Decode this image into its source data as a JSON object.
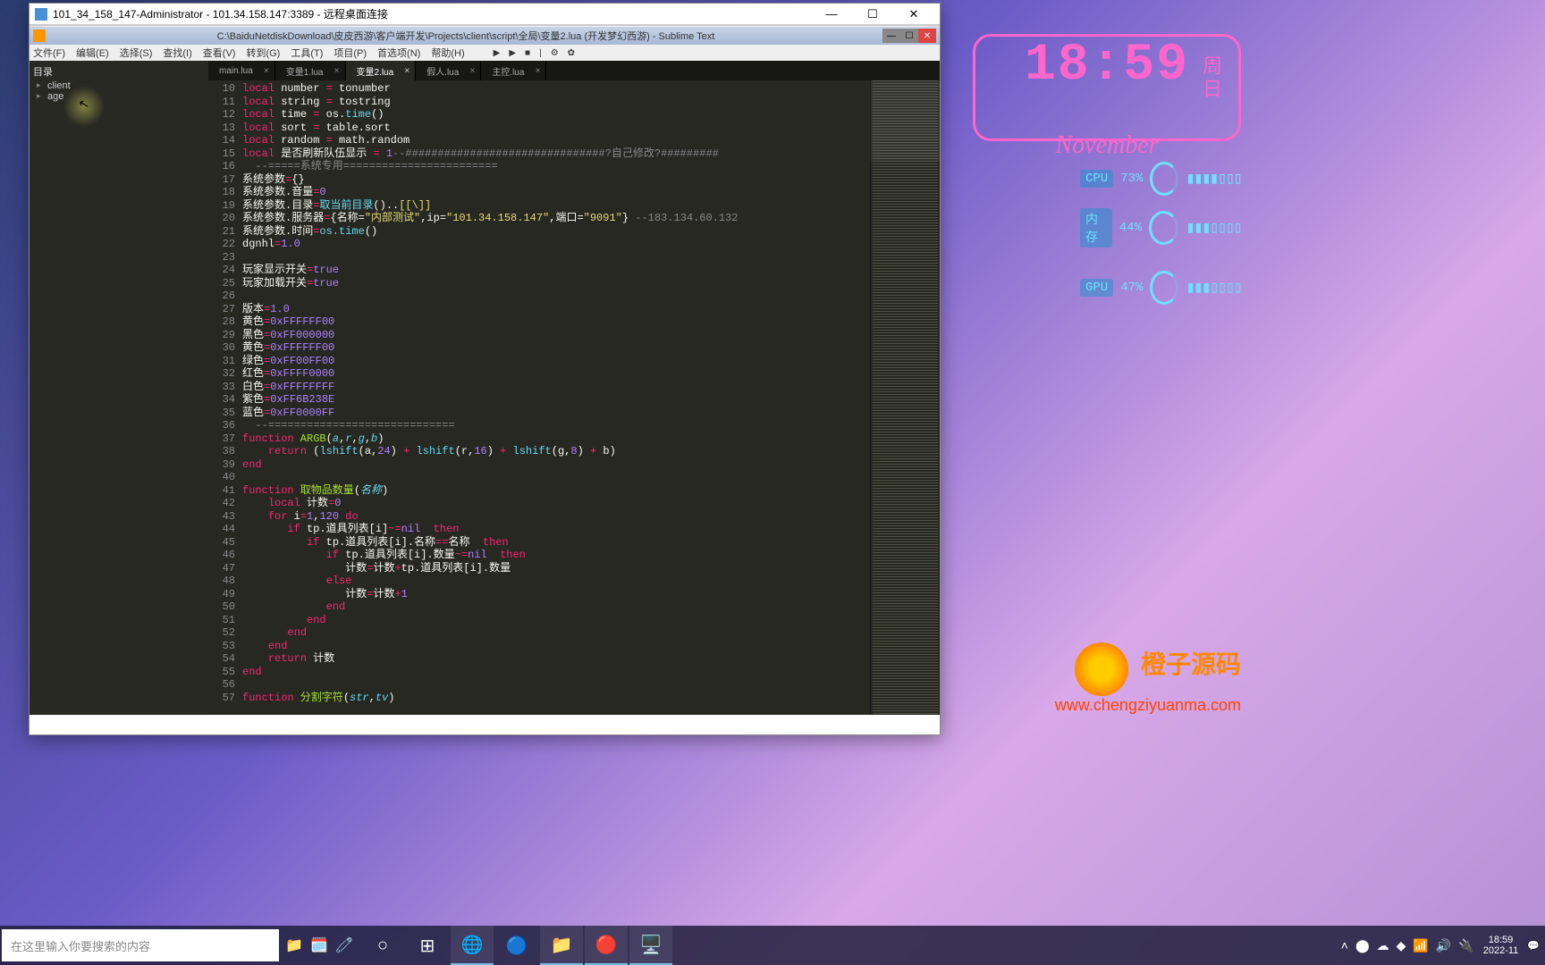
{
  "rdp": {
    "title": "101_34_158_147-Administrator - 101.34.158.147:3389 - 远程桌面连接",
    "controls": {
      "min": "—",
      "max": "☐",
      "close": "✕"
    }
  },
  "sublime": {
    "title": "C:\\BaiduNetdiskDownload\\皮皮西游\\客户端开发\\Projects\\client\\script\\全局\\变量2.lua (开发梦幻西游) - Sublime Text",
    "menu": [
      "文件(F)",
      "编辑(E)",
      "选择(S)",
      "查找(I)",
      "查看(V)",
      "转到(G)",
      "工具(T)",
      "项目(P)",
      "首选项(N)",
      "帮助(H)"
    ],
    "sidebar": {
      "root": "目录",
      "items": [
        "client",
        "age"
      ]
    },
    "tabs": [
      {
        "label": "main.lua",
        "close": "×"
      },
      {
        "label": "变量1.lua",
        "close": "×"
      },
      {
        "label": "变量2.lua",
        "close": "×",
        "active": true
      },
      {
        "label": "假人.lua",
        "close": "×"
      },
      {
        "label": "主控.lua",
        "close": "×"
      }
    ],
    "lines": [
      "10",
      "11",
      "12",
      "13",
      "14",
      "15",
      "16",
      "17",
      "18",
      "19",
      "20",
      "21",
      "22",
      "23",
      "24",
      "25",
      "26",
      "27",
      "28",
      "29",
      "30",
      "31",
      "32",
      "33",
      "34",
      "35",
      "36",
      "37",
      "38",
      "39",
      "40",
      "41",
      "42",
      "43",
      "44",
      "45",
      "46",
      "47",
      "48",
      "49",
      "50",
      "51",
      "52",
      "53",
      "54",
      "55",
      "56",
      "57"
    ],
    "code": {
      "l10": {
        "kw": "local",
        "v": " number ",
        "op": "=",
        "r": " tonumber"
      },
      "l11": {
        "kw": "local",
        "v": " string ",
        "op": "=",
        "r": " tostring"
      },
      "l12": {
        "kw": "local",
        "v": " time ",
        "op": "=",
        "r": " os.",
        "fn": "time",
        "p": "()"
      },
      "l13": {
        "kw": "local",
        "v": " sort ",
        "op": "=",
        "r": " table.sort"
      },
      "l14": {
        "kw": "local",
        "v": " random ",
        "op": "=",
        "r": " math.random"
      },
      "l15": {
        "kw": "local",
        "v": " 是否刷新队伍显示 ",
        "op": "=",
        "n": " 1",
        "cm": "--###############################?自己修改?#########"
      },
      "l16": {
        "cm": "  --=====系统专用========================"
      },
      "l17": {
        "v": "系统参数",
        "op": "=",
        "r": "{}"
      },
      "l18": {
        "v": "系统参数.音量",
        "op": "=",
        "n": "0"
      },
      "l19": {
        "v": "系统参数.目录",
        "op": "=",
        "fn": "取当前目录",
        "p": "()..",
        "s": "[[\\]]"
      },
      "l20": {
        "v": "系统参数.服务器",
        "op": "=",
        "r": "{名称=",
        "s1": "\"内部测试\"",
        "m": ",ip=",
        "s2": "\"101.34.158.147\"",
        "m2": ",端口=",
        "s3": "\"9091\"",
        "r2": "}",
        "cm": " --183.134.60.132"
      },
      "l21": {
        "v": "系统参数.时间",
        "op": "=",
        "fn": "os.time",
        "p": "()"
      },
      "l22": {
        "v": "dgnhl",
        "op": "=",
        "n": "1.0"
      },
      "l23": {
        "v": ""
      },
      "l24": {
        "v": "玩家显示开关",
        "op": "=",
        "n": "true"
      },
      "l25": {
        "v": "玩家加载开关",
        "op": "=",
        "n": "true"
      },
      "l26": {
        "v": ""
      },
      "l27": {
        "v": "版本",
        "op": "=",
        "n": "1.0"
      },
      "l28": {
        "v": "黄色",
        "op": "=",
        "n": "0xFFFFFF00"
      },
      "l29": {
        "v": "黑色",
        "op": "=",
        "n": "0xFF000000"
      },
      "l30": {
        "v": "黄色",
        "op": "=",
        "n": "0xFFFFFF00"
      },
      "l31": {
        "v": "绿色",
        "op": "=",
        "n": "0xFF00FF00"
      },
      "l32": {
        "v": "红色",
        "op": "=",
        "n": "0xFFFF0000"
      },
      "l33": {
        "v": "白色",
        "op": "=",
        "n": "0xFFFFFFFF"
      },
      "l34": {
        "v": "紫色",
        "op": "=",
        "n": "0xFF6B238E"
      },
      "l35": {
        "v": "蓝色",
        "op": "=",
        "n": "0xFF0000FF"
      },
      "l36": {
        "cm": "  --============================="
      },
      "l37": {
        "kw": "function",
        "fn": " ARGB",
        "p": "(",
        "a1": "a",
        "c": ",",
        "a2": "r",
        "c2": ",",
        "a3": "g",
        "c3": ",",
        "a4": "b",
        "p2": ")"
      },
      "l38": {
        "i": "    ",
        "kw": "return",
        "r": " (",
        "fn": "lshift",
        "p": "(a,",
        "n": "24",
        "p2": ") ",
        "op": "+",
        "r2": " ",
        "fn2": "lshift",
        "p3": "(r,",
        "n2": "16",
        "p4": ") ",
        "op2": "+",
        "r3": " ",
        "fn3": "lshift",
        "p5": "(g,",
        "n3": "8",
        "p6": ") ",
        "op3": "+",
        "r4": " b)"
      },
      "l39": {
        "kw": "end"
      },
      "l40": {
        "v": ""
      },
      "l41": {
        "kw": "function",
        "fn": " 取物品数量",
        "p": "(",
        "a": "名称",
        "p2": ")"
      },
      "l42": {
        "i": "    ",
        "kw": "local",
        "v": " 计数",
        "op": "=",
        "n": "0"
      },
      "l43": {
        "i": "    ",
        "kw": "for",
        "v": " i",
        "op": "=",
        "n": "1",
        "c": ",",
        "n2": "120",
        "kw2": " do"
      },
      "l44": {
        "i": "       ",
        "kw": "if",
        "v": " tp.道具列表[i]",
        "op": "~=",
        "n": "nil",
        "kw2": "  then"
      },
      "l45": {
        "i": "          ",
        "kw": "if",
        "v": " tp.道具列表[i].名称",
        "op": "==",
        "v2": "名称",
        "kw2": "  then"
      },
      "l46": {
        "i": "             ",
        "kw": "if",
        "v": " tp.道具列表[i].数量",
        "op": "~=",
        "n": "nil",
        "kw2": "  then"
      },
      "l47": {
        "i": "                ",
        "v": "计数",
        "op": "=",
        "v2": "计数",
        "op2": "+",
        "v3": "tp.道具列表[i].数量"
      },
      "l48": {
        "i": "             ",
        "kw": "else"
      },
      "l49": {
        "i": "                ",
        "v": "计数",
        "op": "=",
        "v2": "计数",
        "op2": "+",
        "n": "1"
      },
      "l50": {
        "i": "             ",
        "kw": "end"
      },
      "l51": {
        "i": "          ",
        "kw": "end"
      },
      "l52": {
        "i": "       ",
        "kw": "end"
      },
      "l53": {
        "i": "    ",
        "kw": "end"
      },
      "l54": {
        "i": "    ",
        "kw": "return",
        "v": " 计数"
      },
      "l55": {
        "kw": "end"
      },
      "l56": {
        "v": ""
      },
      "l57": {
        "kw": "function",
        "fn": " 分割字符",
        "p": "(",
        "a": "str",
        "c": ",",
        "a2": "tv",
        "p2": ")"
      }
    }
  },
  "widgets": {
    "clock": {
      "time": "18:59",
      "day1": "周",
      "day2": "日",
      "month": "November"
    },
    "cpu": {
      "label": "CPU",
      "val": "73%"
    },
    "mem": {
      "label": "内存",
      "val": "44%"
    },
    "gpu": {
      "label": "GPU",
      "val": "47%"
    },
    "brand": "橙子源码",
    "url": "www.chengziyuanma.com"
  },
  "taskbar": {
    "search": "在这里输入你要搜索的内容",
    "tray_time": "18:59",
    "tray_date": "2022-11"
  }
}
